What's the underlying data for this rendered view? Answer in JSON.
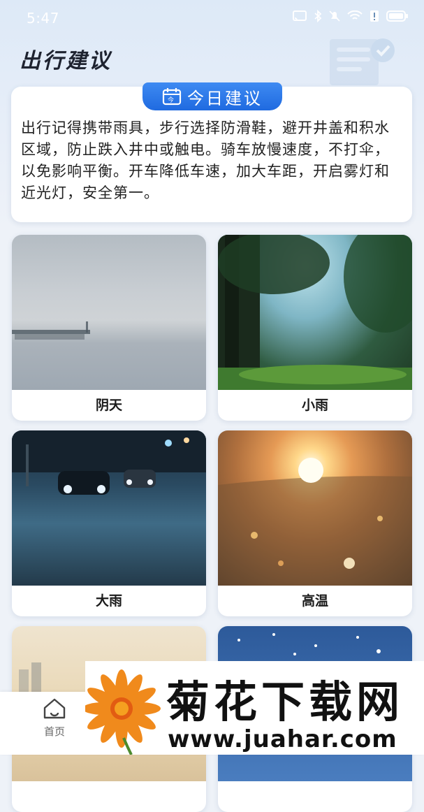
{
  "status_bar": {
    "time": "5:47"
  },
  "page": {
    "title": "出行建议"
  },
  "advice": {
    "badge": "今日建议",
    "text": "出行记得携带雨具，步行选择防滑鞋，避开井盖和积水区域，防止跌入井中或触电。骑车放慢速度，不打伞，以免影响平衡。开车降低车速，加大车距，开启雾灯和近光灯，安全第一。"
  },
  "weather_cards": [
    {
      "label": "阴天"
    },
    {
      "label": "小雨"
    },
    {
      "label": "大雨"
    },
    {
      "label": "高温"
    },
    {
      "label": ""
    },
    {
      "label": ""
    }
  ],
  "bottom_nav": {
    "home_label": "首页"
  },
  "watermark": {
    "name": "菊花下载网",
    "url": "www.juahar.com"
  },
  "colors": {
    "accent": "#2a76ea",
    "background": "#eef2f8"
  }
}
